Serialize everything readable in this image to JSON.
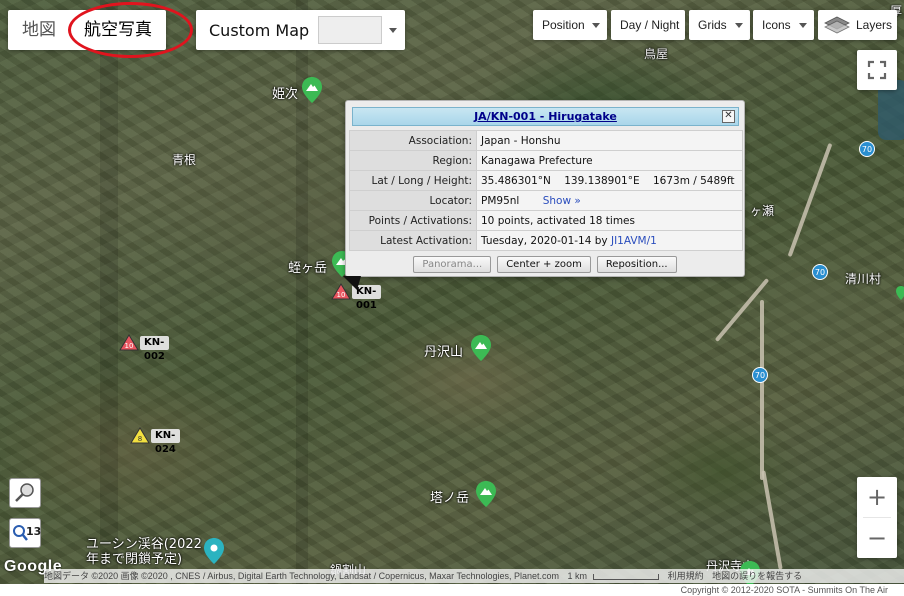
{
  "map_type": {
    "map_label": "地図",
    "satellite_label": "航空写真",
    "custom_map_label": "Custom Map"
  },
  "toolbar": {
    "position": "Position",
    "day_night": "Day / Night",
    "grids": "Grids",
    "icons": "Icons",
    "layers": "Layers"
  },
  "zoom": {
    "in": "+",
    "out": "−",
    "level": "13"
  },
  "place_labels": {
    "himetsugi": "姫次",
    "aone": "青根",
    "hirugatake": "蛭ヶ岳",
    "tanzawasan": "丹沢山",
    "tonodake": "塔ノ岳",
    "yushin_1": "ユーシン渓谷(2022",
    "yushin_2": "年まで閉鎖予定)",
    "torigaya": "鳥屋",
    "kiyokawa": "清川村",
    "segase": "ヶ瀬",
    "tanzawa_terayama": "丹沢寺山",
    "bottom_partial": "鍋割山",
    "edge_partial": "厚"
  },
  "road_numbers": {
    "r70": "70"
  },
  "summits": [
    {
      "ref": "KN-001",
      "points": "10",
      "color": "#e8555f"
    },
    {
      "ref": "KN-002",
      "points": "10",
      "color": "#e8555f"
    },
    {
      "ref": "KN-024",
      "points": "8",
      "color": "#f2e040"
    }
  ],
  "info": {
    "title": "JA/KN-001 - Hirugatake",
    "close": "✕",
    "rows": {
      "association_k": "Association:",
      "association_v": "Japan - Honshu",
      "region_k": "Region:",
      "region_v": "Kanagawa Prefecture",
      "latlong_k": "Lat / Long / Height:",
      "lat": "35.486301°N",
      "lon": "139.138901°E",
      "height": "1673m / 5489ft",
      "locator_k": "Locator:",
      "locator_v": "PM95nl",
      "locator_show": "Show »",
      "points_k": "Points / Activations:",
      "points_v": "10 points,  activated 18 times",
      "latest_k": "Latest Activation:",
      "latest_date": "Tuesday, 2020-01-14 by",
      "latest_call": "JI1AVM/1"
    },
    "buttons": {
      "panorama": "Panorama...",
      "center_zoom": "Center + zoom",
      "reposition": "Reposition..."
    }
  },
  "attribution": {
    "data": "地図データ ©2020 画像 ©2020 , CNES / Airbus, Digital Earth Technology, Landsat / Copernicus, Maxar Technologies, Planet.com",
    "scale": "1 km",
    "terms": "利用規約",
    "report": "地図の誤りを報告する",
    "google": "Google"
  },
  "footer": "Copyright © 2012-2020 SOTA - Summits On The Air"
}
